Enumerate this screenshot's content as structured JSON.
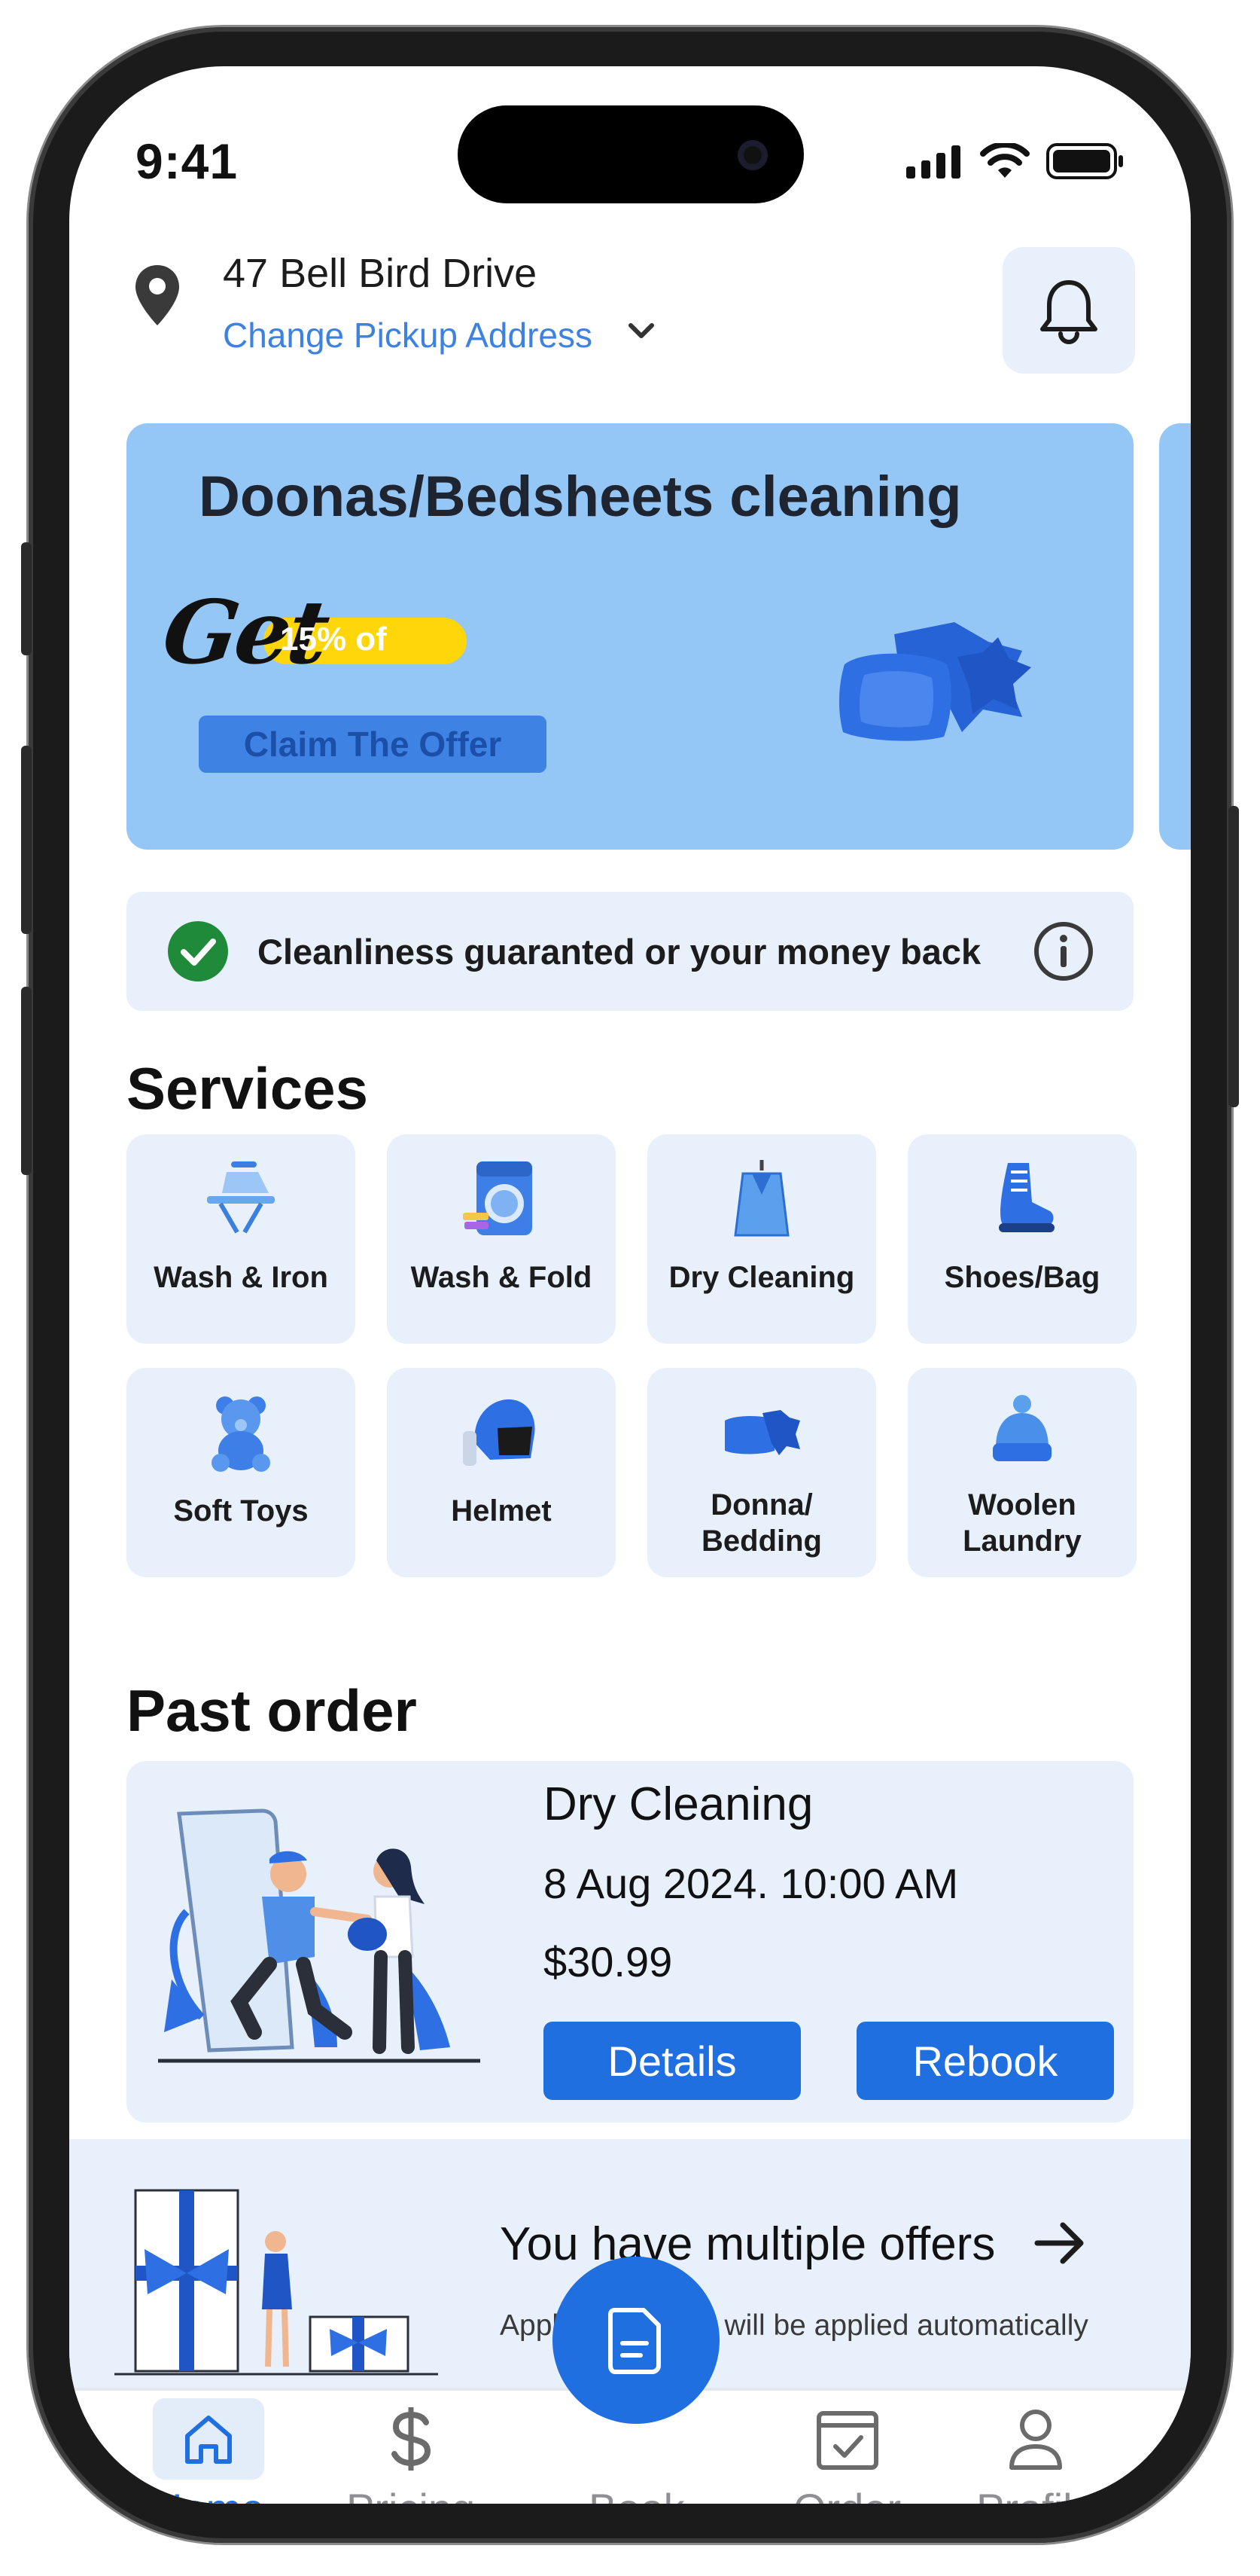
{
  "status_bar": {
    "time": "9:41"
  },
  "header": {
    "address": "47 Bell Bird Drive",
    "change_label": "Change Pickup Address"
  },
  "banner": {
    "title": "Doonas/Bedsheets cleaning",
    "get_label": "Get",
    "discount": "15% of",
    "cta": "Claim The Offer"
  },
  "guarantee": {
    "text": "Cleanliness guaranted or your money back"
  },
  "services": {
    "title": "Services",
    "items": [
      {
        "label": "Wash & Iron",
        "icon": "iron-icon"
      },
      {
        "label": "Wash & Fold",
        "icon": "washing-machine-icon"
      },
      {
        "label": "Dry Cleaning",
        "icon": "garment-bag-icon"
      },
      {
        "label": "Shoes/Bag",
        "icon": "sneaker-icon"
      },
      {
        "label": "Soft Toys",
        "icon": "teddy-bear-icon"
      },
      {
        "label": "Helmet",
        "icon": "helmet-icon"
      },
      {
        "label_line1": "Donna/",
        "label_line2": "Bedding",
        "icon": "pillows-icon"
      },
      {
        "label_line1": "Woolen",
        "label_line2": "Laundry",
        "icon": "beanie-icon"
      }
    ]
  },
  "past_order": {
    "title": "Past order",
    "service": "Dry Cleaning",
    "date": "8 Aug 2024. 10:00 AM",
    "price": "$30.99",
    "details_label": "Details",
    "rebook_label": "Rebook"
  },
  "offers": {
    "title": "You have multiple offers",
    "subtitle": "Applicable offers will be applied automatically"
  },
  "bottom_nav": {
    "items": [
      {
        "label": "Home",
        "icon": "home-icon",
        "active": true
      },
      {
        "label": "Pricing",
        "icon": "dollar-icon"
      },
      {
        "label": "Book",
        "icon": "document-icon"
      },
      {
        "label": "Order",
        "icon": "calendar-check-icon"
      },
      {
        "label": "Profile",
        "icon": "user-icon"
      }
    ]
  },
  "colors": {
    "primary": "#1f6fe0",
    "link": "#3d82e0",
    "banner_bg": "#94c6f6",
    "card_bg": "#e8f0fb",
    "badge_yellow": "#ffd60a",
    "check_green": "#1f8a3a"
  }
}
